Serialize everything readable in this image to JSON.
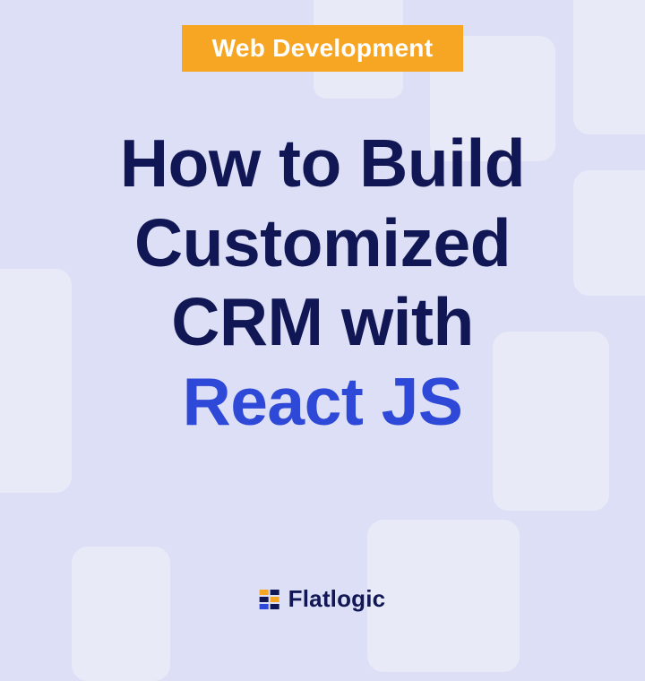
{
  "badge": {
    "label": "Web Development"
  },
  "heading": {
    "line1": "How to Build",
    "line2": "Customized",
    "line3": "CRM with",
    "line4": "React JS"
  },
  "brand": {
    "name": "Flatlogic"
  },
  "colors": {
    "background": "#dcdff5",
    "badge_bg": "#f6a623",
    "badge_text": "#ffffff",
    "heading_dark": "#111754",
    "heading_accent": "#2e48d8"
  }
}
